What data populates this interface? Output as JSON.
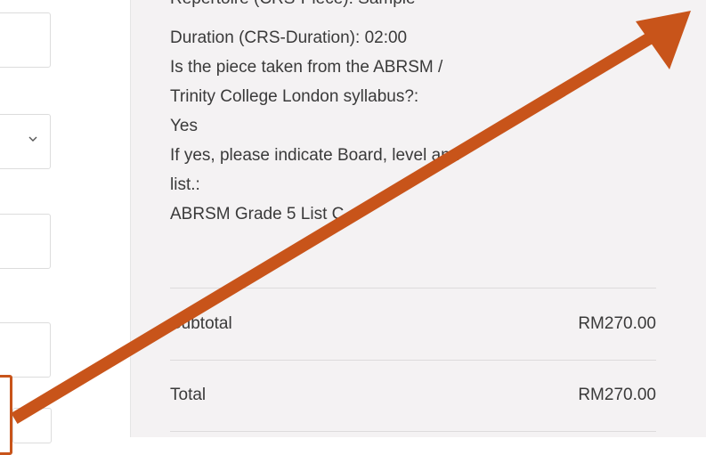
{
  "order_summary": {
    "lines": [
      "Repertoire (CRS-Piece): Sample",
      "Duration (CRS-Duration): 02:00",
      "Is the piece taken from the ABRSM /",
      "Trinity College London syllabus?:",
      "Yes",
      "If yes, please indicate Board, level and",
      "list.:",
      "ABRSM Grade 5 List C"
    ],
    "subtotal_label": "Subtotal",
    "subtotal_value": "RM270.00",
    "total_label": "Total",
    "total_value": "RM270.00"
  },
  "annotation": {
    "arrow_color": "#c8541a",
    "arrow_icon": "arrow-up-right-icon"
  },
  "icons": {
    "select_chevron": "chevron-down-icon"
  }
}
